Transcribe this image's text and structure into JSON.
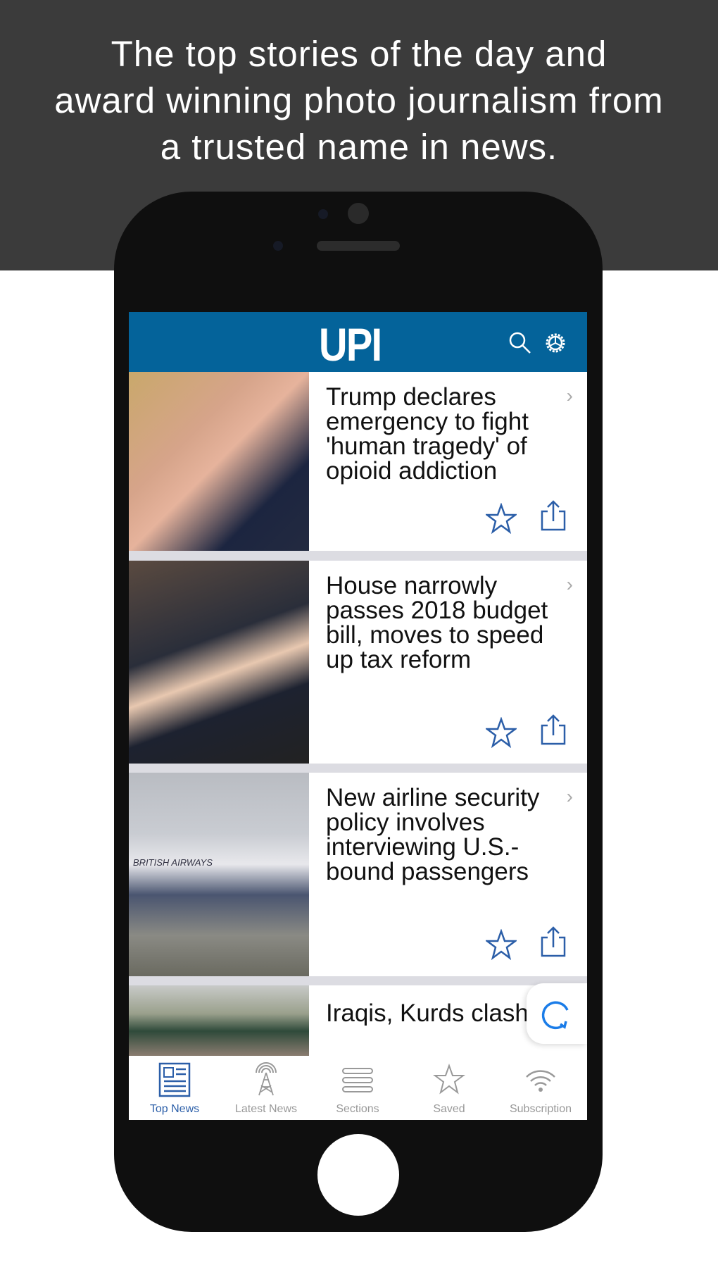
{
  "tagline": [
    "The top stories of the day and",
    "award winning photo journalism from",
    "a trusted name in news."
  ],
  "app": {
    "logo": "UPI",
    "accent": "#04639a"
  },
  "articles": [
    {
      "headline": "Trump declares emergency to fight 'human tragedy' of opioid addiction"
    },
    {
      "headline": "House narrowly passes 2018 budget bill, moves to speed up tax reform"
    },
    {
      "headline": "New airline security policy involves interviewing U.S.-bound passengers",
      "image_text": "BRITISH AIRWAYS"
    },
    {
      "headline": "Iraqis, Kurds clash at key Syria border"
    }
  ],
  "tabs": [
    {
      "label": "Top News",
      "icon": "newspaper-icon",
      "active": true
    },
    {
      "label": "Latest News",
      "icon": "antenna-icon",
      "active": false
    },
    {
      "label": "Sections",
      "icon": "menu-icon",
      "active": false
    },
    {
      "label": "Saved",
      "icon": "star-icon",
      "active": false
    },
    {
      "label": "Subscription",
      "icon": "wifi-icon",
      "active": false
    }
  ]
}
